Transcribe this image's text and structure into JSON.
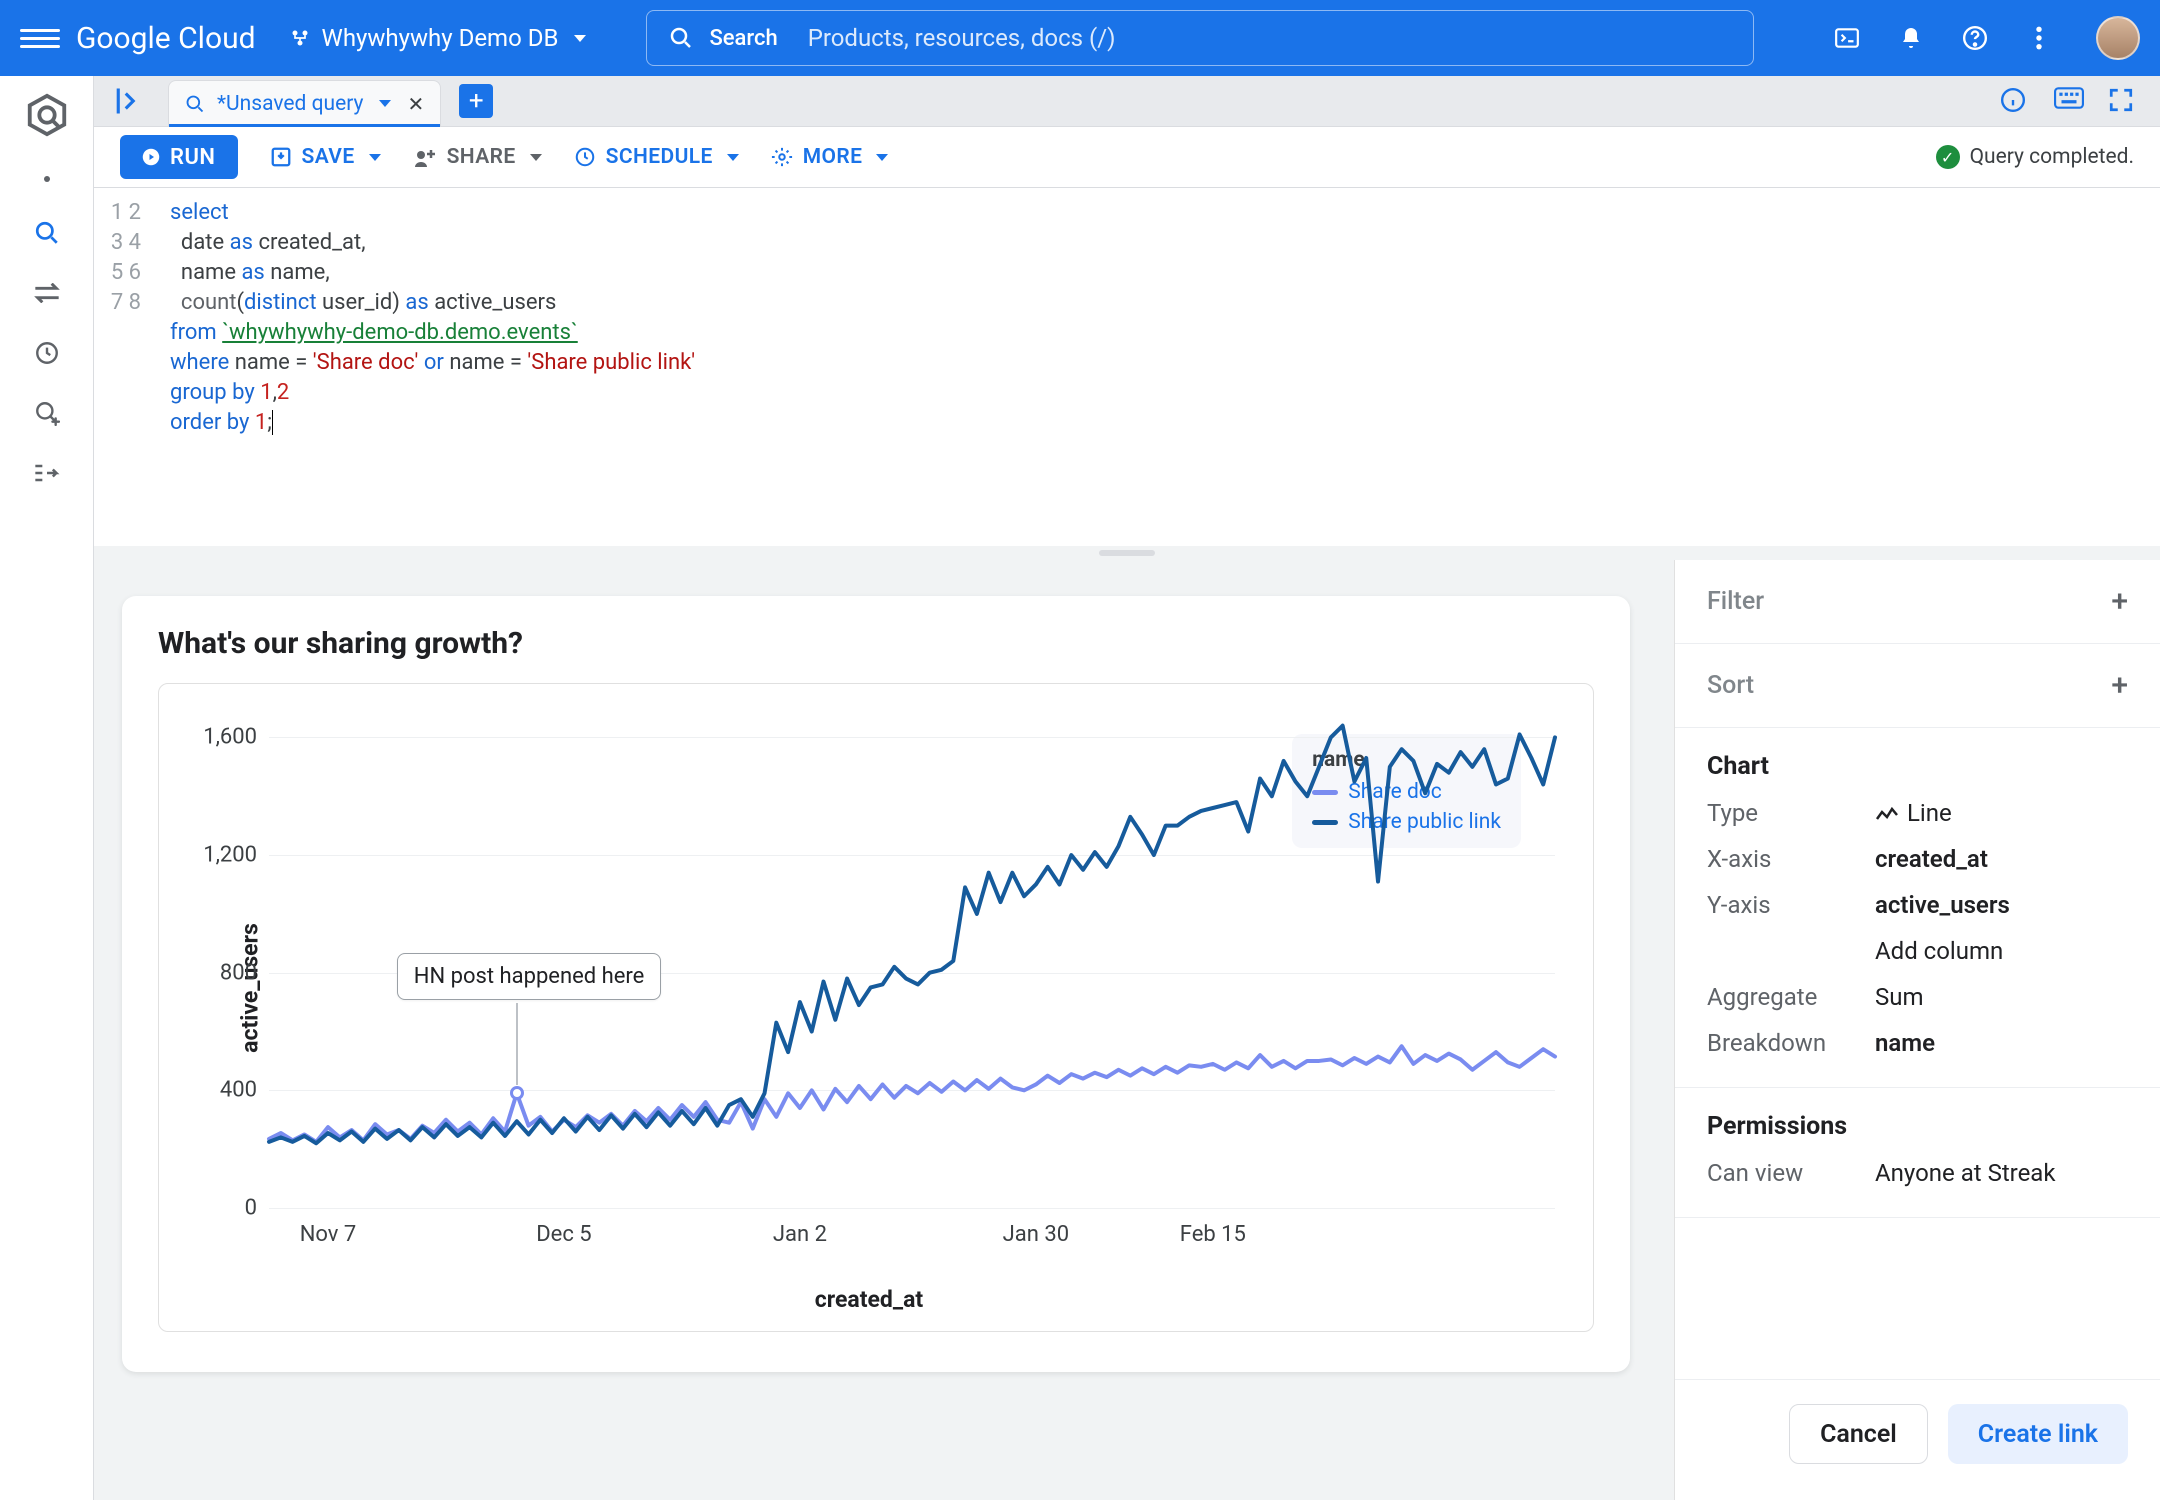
{
  "header": {
    "product": "Google Cloud",
    "project": "Whywhywhy Demo DB",
    "search_label": "Search",
    "search_placeholder": "Products, resources, docs (/)"
  },
  "tabs": {
    "unsaved": "*Unsaved query"
  },
  "toolbar": {
    "run": "RUN",
    "save": "SAVE",
    "share": "SHARE",
    "schedule": "SCHEDULE",
    "more": "MORE",
    "status": "Query completed."
  },
  "sql": {
    "l1": "select",
    "l2_a": "date",
    "l2_b": "as",
    "l2_c": "created_at,",
    "l3_a": "name",
    "l3_b": "as",
    "l3_c": "name,",
    "l4_a": "count",
    "l4_b": "distinct",
    "l4_c": "user_id",
    "l4_d": "as",
    "l4_e": "active_users",
    "l5_a": "from",
    "l5_b": "`whywhywhy-demo-db.demo.events`",
    "l6_a": "where",
    "l6_b": "name",
    "l6_c": "=",
    "l6_d": "'Share doc'",
    "l6_e": "or",
    "l6_f": "name",
    "l6_g": "=",
    "l6_h": "'Share public link'",
    "l7_a": "group by",
    "l7_b": "1",
    "l7_c": ",",
    "l7_d": "2",
    "l8_a": "order by",
    "l8_b": "1",
    "l8_c": ";"
  },
  "card": {
    "title": "What's our sharing growth?",
    "ylabel": "active_users",
    "xlabel": "created_at",
    "annotation": "HN post happened here",
    "legend_title": "name",
    "legend_a": "Share doc",
    "legend_b": "Share public link"
  },
  "right": {
    "filter": "Filter",
    "sort": "Sort",
    "chart": "Chart",
    "type_k": "Type",
    "type_v": "Line",
    "x_k": "X-axis",
    "x_v": "created_at",
    "y_k": "Y-axis",
    "y_v": "active_users",
    "add_col": "Add column",
    "agg_k": "Aggregate",
    "agg_v": "Sum",
    "brk_k": "Breakdown",
    "brk_v": "name",
    "perm": "Permissions",
    "canview_k": "Can view",
    "canview_v": "Anyone at Streak",
    "cancel": "Cancel",
    "create": "Create link"
  },
  "chart_data": {
    "type": "line",
    "xlabel": "created_at",
    "ylabel": "active_users",
    "ylim": [
      0,
      1700
    ],
    "y_ticks": [
      0,
      400,
      800,
      1200,
      1600
    ],
    "x_ticks": [
      "Nov 7",
      "Dec 5",
      "Jan 2",
      "Jan 30",
      "Feb 15"
    ],
    "legend": [
      "Share doc",
      "Share public link"
    ],
    "annotation": {
      "text": "HN post happened here",
      "x_index": 21,
      "y": 390
    },
    "x": [
      0,
      1,
      2,
      3,
      4,
      5,
      6,
      7,
      8,
      9,
      10,
      11,
      12,
      13,
      14,
      15,
      16,
      17,
      18,
      19,
      20,
      21,
      22,
      23,
      24,
      25,
      26,
      27,
      28,
      29,
      30,
      31,
      32,
      33,
      34,
      35,
      36,
      37,
      38,
      39,
      40,
      41,
      42,
      43,
      44,
      45,
      46,
      47,
      48,
      49,
      50,
      51,
      52,
      53,
      54,
      55,
      56,
      57,
      58,
      59,
      60,
      61,
      62,
      63,
      64,
      65,
      66,
      67,
      68,
      69,
      70,
      71,
      72,
      73,
      74,
      75,
      76,
      77,
      78,
      79,
      80,
      81,
      82,
      83,
      84,
      85,
      86,
      87,
      88,
      89,
      90,
      91,
      92,
      93,
      94,
      95,
      96,
      97,
      98,
      99,
      100,
      101,
      102,
      103,
      104,
      105,
      106,
      107,
      108,
      109
    ],
    "series": [
      {
        "name": "Share doc",
        "color": "#7a8cf0",
        "values": [
          235,
          255,
          230,
          250,
          225,
          275,
          240,
          265,
          230,
          285,
          250,
          265,
          235,
          280,
          255,
          300,
          260,
          290,
          250,
          305,
          260,
          390,
          280,
          310,
          260,
          300,
          275,
          315,
          290,
          320,
          280,
          330,
          295,
          340,
          300,
          350,
          310,
          360,
          300,
          290,
          360,
          270,
          370,
          310,
          390,
          340,
          400,
          335,
          405,
          360,
          415,
          370,
          420,
          375,
          415,
          390,
          425,
          395,
          430,
          400,
          435,
          405,
          440,
          410,
          400,
          420,
          450,
          425,
          455,
          440,
          460,
          445,
          470,
          450,
          475,
          455,
          480,
          460,
          485,
          480,
          490,
          470,
          495,
          475,
          520,
          480,
          500,
          475,
          500,
          500,
          505,
          485,
          510,
          490,
          515,
          495,
          550,
          490,
          520,
          500,
          525,
          505,
          470,
          500,
          530,
          495,
          480,
          510,
          540,
          515
        ]
      },
      {
        "name": "Share public link",
        "color": "#165b9c",
        "values": [
          225,
          240,
          225,
          245,
          220,
          255,
          230,
          260,
          225,
          270,
          235,
          265,
          230,
          275,
          240,
          285,
          245,
          275,
          240,
          290,
          245,
          295,
          250,
          300,
          255,
          305,
          260,
          310,
          265,
          315,
          270,
          320,
          275,
          325,
          280,
          330,
          285,
          340,
          280,
          350,
          370,
          310,
          390,
          630,
          530,
          700,
          600,
          770,
          640,
          780,
          690,
          750,
          760,
          820,
          780,
          760,
          800,
          810,
          840,
          1090,
          1000,
          1140,
          1040,
          1140,
          1060,
          1100,
          1160,
          1100,
          1200,
          1150,
          1210,
          1160,
          1230,
          1330,
          1270,
          1200,
          1300,
          1300,
          1330,
          1350,
          1360,
          1370,
          1380,
          1280,
          1460,
          1400,
          1520,
          1450,
          1400,
          1500,
          1600,
          1640,
          1450,
          1530,
          1110,
          1500,
          1560,
          1520,
          1410,
          1510,
          1480,
          1550,
          1500,
          1560,
          1440,
          1460,
          1610,
          1530,
          1440,
          1600
        ]
      }
    ]
  }
}
